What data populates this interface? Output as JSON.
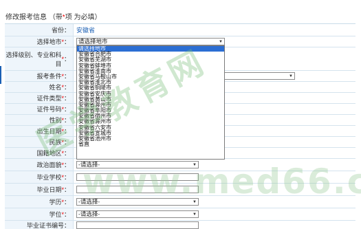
{
  "page_title": "修改报考信息",
  "page_note_open": "（带",
  "page_note_star": "*",
  "page_note_close": "项 为必填）",
  "required_mark": "*",
  "rows": {
    "province": {
      "label": "省份",
      "value": "安徽省"
    },
    "city": {
      "label": "选择地市",
      "value": "请选择地市"
    },
    "level": {
      "label": "选择级别、专业和科目"
    },
    "exam_cond": {
      "label": "报考条件"
    },
    "name": {
      "label": "姓名"
    },
    "cert_type": {
      "label": "证件类型"
    },
    "cert_no": {
      "label": "证件号码"
    },
    "gender": {
      "label": "性别"
    },
    "birth": {
      "label": "出生日期"
    },
    "ethnic": {
      "label": "民族"
    },
    "nationality": {
      "label": "国籍地区"
    },
    "political": {
      "label": "政治面貌",
      "value": "-请选择-"
    },
    "school": {
      "label": "毕业学校"
    },
    "grad_date": {
      "label": "毕业日期"
    },
    "education": {
      "label": "学历",
      "value": "-请选择-"
    },
    "degree": {
      "label": "学位",
      "value": "-请选择-"
    },
    "grad_cert": {
      "label": "毕业证书编号"
    }
  },
  "city_dropdown": [
    "请选择地市",
    "安徽省合肥市",
    "安徽省芜湖市",
    "安徽省蚌埠市",
    "安徽省淮南市",
    "安徽省马鞍山市",
    "安徽省淮北市",
    "安徽省铜陵市",
    "安徽省安庆市",
    "安徽省黄山市",
    "安徽省滁州市",
    "安徽省阜阳市",
    "安徽省宿州市",
    "安徽省滁州市",
    "安徽省六安市",
    "安徽省宣城市",
    "安徽省池州市",
    "省直"
  ],
  "watermark_1": "医学教育网",
  "watermark_2": "www.med66.com",
  "colors": {
    "label_bg": "#eef5fb",
    "border": "#d4e3ee",
    "required": "#e00000",
    "selected": "#2b6ed3",
    "link": "#1a5fb4"
  }
}
